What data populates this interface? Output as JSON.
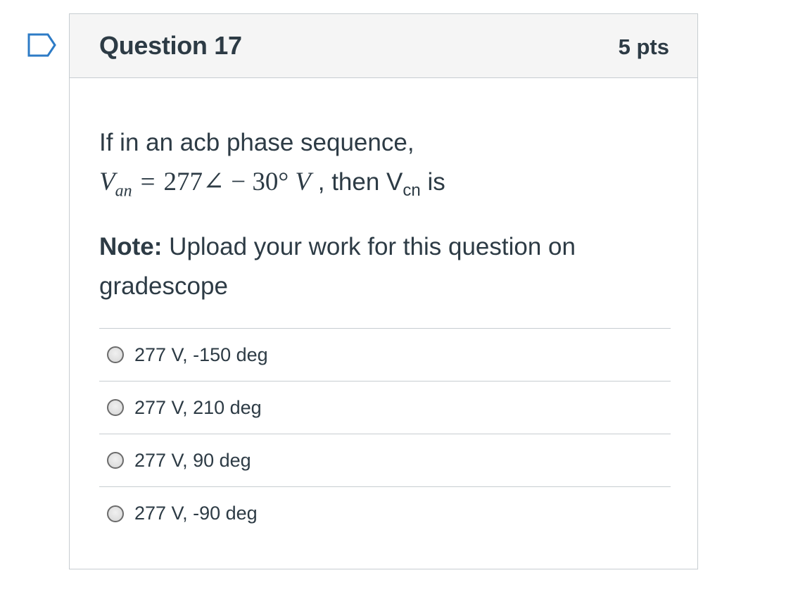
{
  "flag": {
    "icon": "flag-outline-icon",
    "color": "#2d7bc6"
  },
  "question": {
    "title": "Question 17",
    "points": "5 pts",
    "text_line1": "If in an acb phase sequence,",
    "math_var": "V",
    "math_sub": "an",
    "math_eq": "=",
    "math_value": "277∠ − 30°",
    "math_unit": "V",
    "text_after_math": " , then V",
    "text_sub": "cn",
    "text_end": " is",
    "note_label": "Note:",
    "note_text": " Upload your work for this question on gradescope"
  },
  "answers": [
    {
      "label": "277 V, -150 deg",
      "selected": false
    },
    {
      "label": "277 V, 210 deg",
      "selected": false
    },
    {
      "label": "277 V, 90 deg",
      "selected": false
    },
    {
      "label": "277 V, -90 deg",
      "selected": false
    }
  ],
  "colors": {
    "text": "#2d3b45",
    "border": "#c7cdd1",
    "header_bg": "#f5f5f5",
    "flag": "#2d7bc6"
  }
}
